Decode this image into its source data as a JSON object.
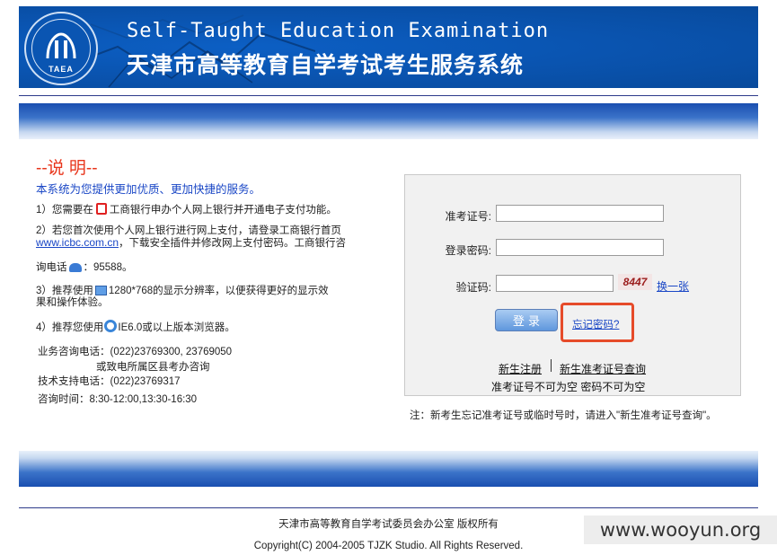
{
  "header": {
    "logo_abbr": "TAEA",
    "title_en": "Self-Taught Education Examination",
    "title_cn": "天津市高等教育自学考试考生服务系统"
  },
  "notice": {
    "title": "--说 明--",
    "subtitle": "本系统为您提供更加优质、更加快捷的服务。",
    "item1_pre": "1）您需要在",
    "item1_post": "工商银行申办个人网上银行并开通电子支付功能。",
    "item2_a": "2）若您首次使用个人网上银行进行网上支付，请登录工商银行首页",
    "item2_link": "www.icbc.com.cn",
    "item2_b": "，下载安全插件并修改网上支付密码。工商银行咨",
    "item2_c_pre": "询电话",
    "item2_c_post": "：95588。",
    "item3_pre": "3）推荐使用",
    "item3_post": "1280*768的显示分辨率，以便获得更好的显示效果和操作体验。",
    "item4_pre": "4）推荐您使用",
    "item4_post": "IE6.0或以上版本浏览器。"
  },
  "contact": {
    "biz_label": "业务咨询电话：",
    "biz_value": "(022)23769300, 23769050",
    "biz_extra": "或致电所属区县考办咨询",
    "tech_label": "技术支持电话：",
    "tech_value": "(022)23769317",
    "hours_label": "咨询时间：",
    "hours_value": "8:30-12:00,13:30-16:30"
  },
  "login": {
    "exam_id_label": "准考证号:",
    "password_label": "登录密码:",
    "captcha_label": "验证码:",
    "captcha_code": "8447",
    "refresh_label": "换一张",
    "login_button": "登 录",
    "forgot_link": "忘记密码?",
    "register_link": "新生注册",
    "lookup_link": "新生准考证号查询",
    "warning": "准考证号不可为空  密码不可为空"
  },
  "tip": "注：新考生忘记准考证号或临时号时，请进入\"新生准考证号查询\"。",
  "footer": {
    "owner": "天津市高等教育自学考试委员会办公室 版权所有",
    "copyright": "Copyright(C) 2004-2005 TJZK Studio. All Rights Reserved."
  },
  "watermark": "www.wooyun.org",
  "colors": {
    "banner": "#0a55b2",
    "accent_red": "#e8351b",
    "link_blue": "#1a47c6",
    "highlight_box": "#e64b2a"
  }
}
